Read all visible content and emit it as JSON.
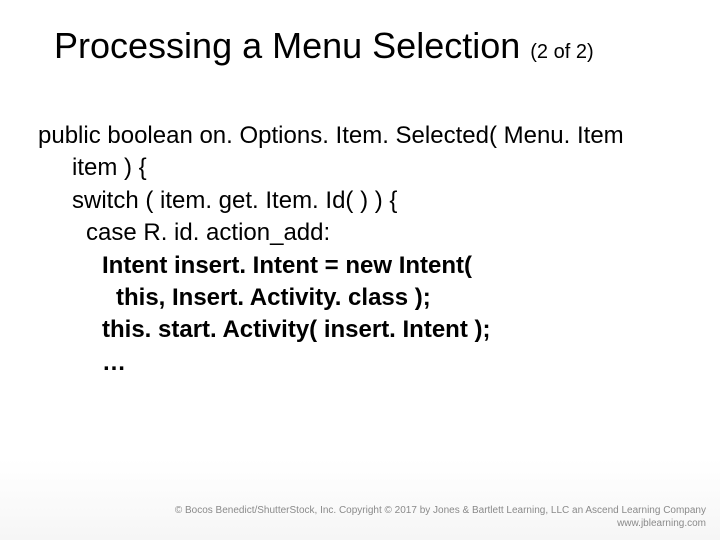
{
  "title": {
    "text": "Processing a Menu Selection ",
    "pager": "(2 of 2)"
  },
  "code": {
    "line1": "public boolean on. Options. Item. Selected( Menu. Item",
    "line2": "item ) {",
    "line3": "switch ( item. get. Item. Id( ) ) {",
    "line4": "case R. id. action_add:",
    "line5": "Intent insert. Intent = new Intent(",
    "line6": "this, Insert. Activity. class );",
    "line7": "this. start. Activity( insert. Intent );",
    "line8": "…"
  },
  "footer": {
    "line1": "© Bocos Benedict/ShutterStock, Inc. Copyright © 2017 by Jones & Bartlett Learning, LLC an Ascend Learning Company",
    "line2": "www.jblearning.com"
  }
}
